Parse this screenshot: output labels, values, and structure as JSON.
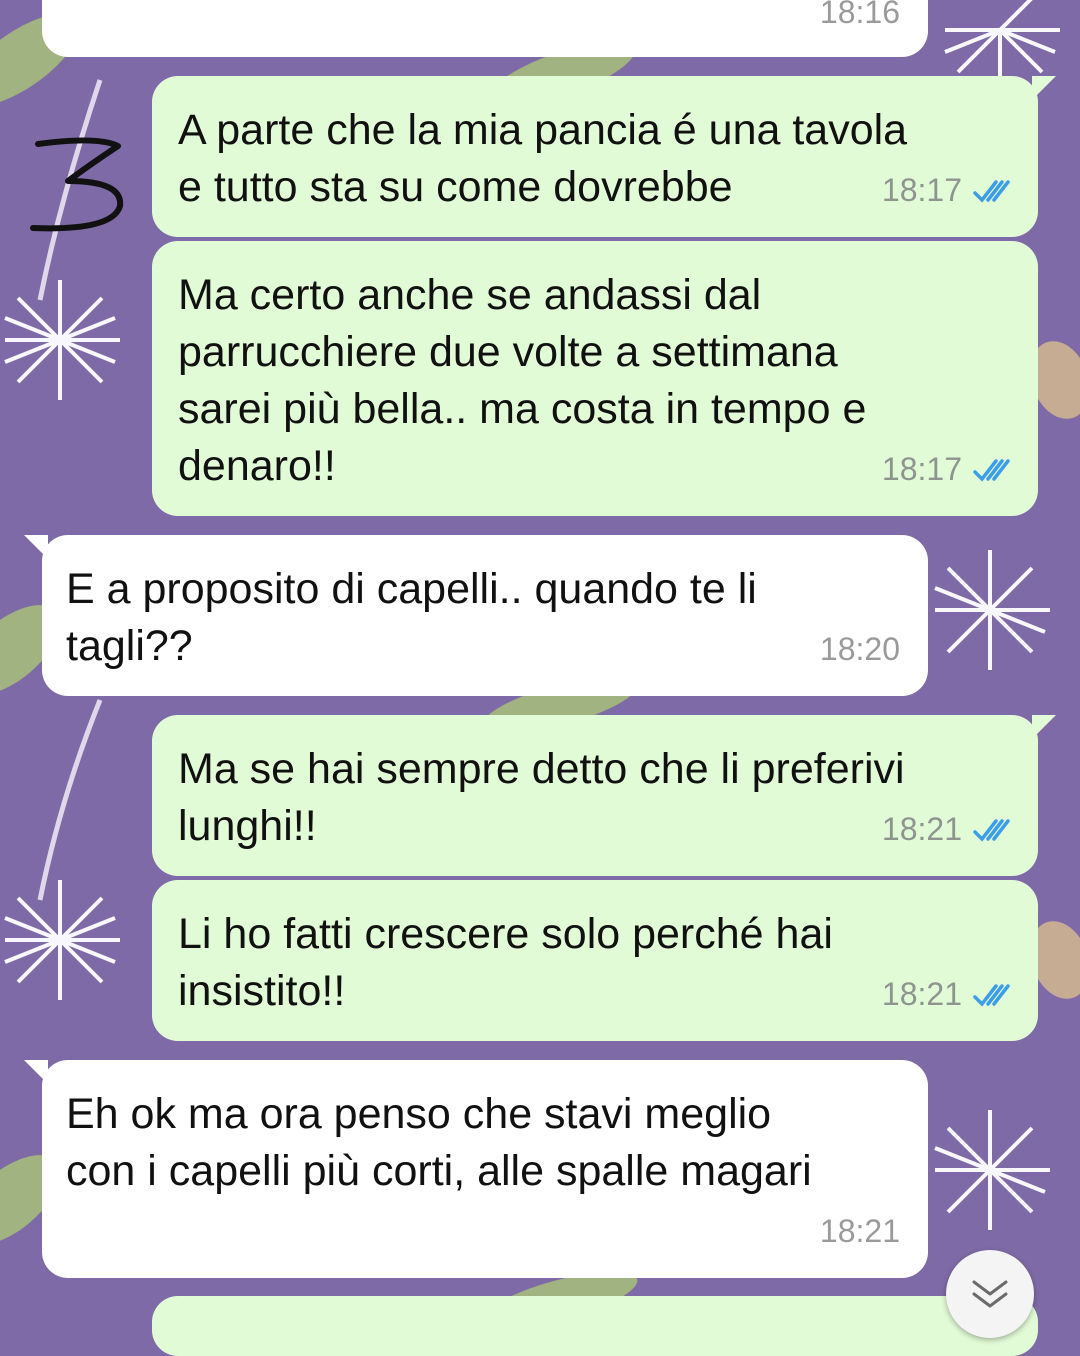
{
  "annotation": {
    "mark": "3"
  },
  "messages": [
    {
      "id": "m0",
      "direction": "in",
      "text": "",
      "time": "18:16"
    },
    {
      "id": "m1",
      "direction": "out",
      "text": "A parte che la mia pancia é una tavola\ne tutto sta su come dovrebbe",
      "time": "18:17",
      "status_icon": "double-check-read-icon"
    },
    {
      "id": "m2",
      "direction": "out",
      "text": "Ma certo anche se andassi dal\nparrucchiere due volte a settimana\nsarei più bella.. ma costa in tempo e\ndenaro!!",
      "time": "18:17",
      "status_icon": "double-check-read-icon"
    },
    {
      "id": "m3",
      "direction": "in",
      "text": "E a proposito di capelli.. quando te li\ntagli??",
      "time": "18:20"
    },
    {
      "id": "m4",
      "direction": "out",
      "text": "Ma se hai sempre detto che li preferivi\nlunghi!!",
      "time": "18:21",
      "status_icon": "double-check-read-icon"
    },
    {
      "id": "m5",
      "direction": "out",
      "text": "Li ho fatti crescere solo perché hai\ninsistito!!",
      "time": "18:21",
      "status_icon": "double-check-read-icon"
    },
    {
      "id": "m6",
      "direction": "in",
      "text": "Eh ok ma ora penso che stavi meglio\ncon i capelli più corti, alle spalle magari",
      "time": "18:21"
    }
  ],
  "scroll_button": {
    "icon": "chevron-double-down-icon"
  },
  "colors": {
    "wallpaper": "#7e6aa6",
    "outgoing_bubble": "#e2fbd7",
    "incoming_bubble": "#ffffff",
    "read_ticks": "#3d9ee8"
  }
}
